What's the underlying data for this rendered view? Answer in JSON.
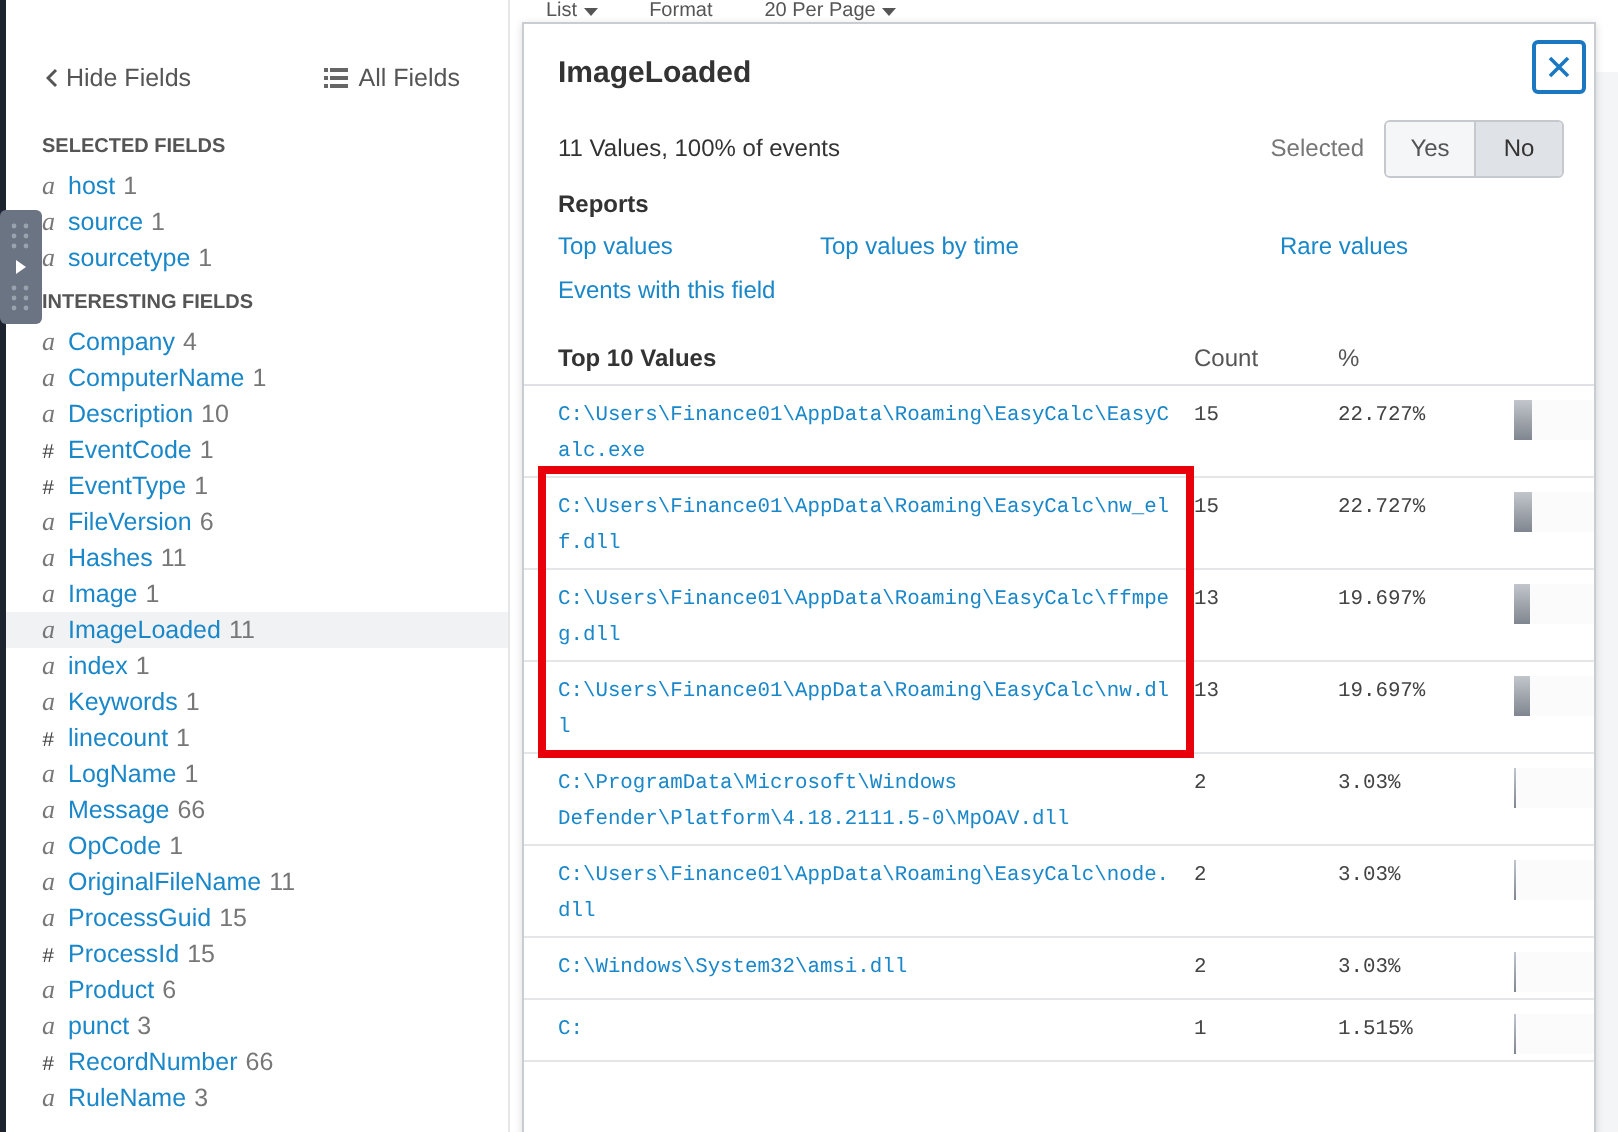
{
  "toolbar": [
    {
      "label": "List",
      "caret": true
    },
    {
      "label": "Format",
      "caret": false
    },
    {
      "label": "20 Per Page",
      "caret": true
    }
  ],
  "sidebar": {
    "hide_label": "Hide Fields",
    "all_label": "All Fields",
    "sections": [
      {
        "title": "SELECTED FIELDS",
        "fields": [
          {
            "type": "a",
            "name": "host",
            "count": "1",
            "selected": false
          },
          {
            "type": "a",
            "name": "source",
            "count": "1",
            "selected": false
          },
          {
            "type": "a",
            "name": "sourcetype",
            "count": "1",
            "selected": false
          }
        ]
      },
      {
        "title": "INTERESTING FIELDS",
        "fields": [
          {
            "type": "a",
            "name": "Company",
            "count": "4",
            "selected": false
          },
          {
            "type": "a",
            "name": "ComputerName",
            "count": "1",
            "selected": false
          },
          {
            "type": "a",
            "name": "Description",
            "count": "10",
            "selected": false
          },
          {
            "type": "#",
            "name": "EventCode",
            "count": "1",
            "selected": false
          },
          {
            "type": "#",
            "name": "EventType",
            "count": "1",
            "selected": false
          },
          {
            "type": "a",
            "name": "FileVersion",
            "count": "6",
            "selected": false
          },
          {
            "type": "a",
            "name": "Hashes",
            "count": "11",
            "selected": false
          },
          {
            "type": "a",
            "name": "Image",
            "count": "1",
            "selected": false
          },
          {
            "type": "a",
            "name": "ImageLoaded",
            "count": "11",
            "selected": true
          },
          {
            "type": "a",
            "name": "index",
            "count": "1",
            "selected": false
          },
          {
            "type": "a",
            "name": "Keywords",
            "count": "1",
            "selected": false
          },
          {
            "type": "#",
            "name": "linecount",
            "count": "1",
            "selected": false
          },
          {
            "type": "a",
            "name": "LogName",
            "count": "1",
            "selected": false
          },
          {
            "type": "a",
            "name": "Message",
            "count": "66",
            "selected": false
          },
          {
            "type": "a",
            "name": "OpCode",
            "count": "1",
            "selected": false
          },
          {
            "type": "a",
            "name": "OriginalFileName",
            "count": "11",
            "selected": false
          },
          {
            "type": "a",
            "name": "ProcessGuid",
            "count": "15",
            "selected": false
          },
          {
            "type": "#",
            "name": "ProcessId",
            "count": "15",
            "selected": false
          },
          {
            "type": "a",
            "name": "Product",
            "count": "6",
            "selected": false
          },
          {
            "type": "a",
            "name": "punct",
            "count": "3",
            "selected": false
          },
          {
            "type": "#",
            "name": "RecordNumber",
            "count": "66",
            "selected": false
          },
          {
            "type": "a",
            "name": "RuleName",
            "count": "3",
            "selected": false
          }
        ]
      }
    ]
  },
  "popup": {
    "title": "ImageLoaded",
    "summary": "11 Values, 100% of events",
    "selected_label": "Selected",
    "toggle": [
      {
        "label": "Yes",
        "selected": false
      },
      {
        "label": "No",
        "selected": true
      }
    ],
    "reports_title": "Reports",
    "reports": [
      "Top values",
      "Top values by time",
      "Rare values",
      "Events with this field"
    ],
    "table": {
      "columns": [
        "Top 10 Values",
        "Count",
        "%"
      ],
      "rows": [
        {
          "value": "C:\\Users\\Finance01\\AppData\\Roaming\\EasyCalc\\EasyCalc.exe",
          "count": "15",
          "percent": "22.727%",
          "level": 0.22727,
          "highlighted": false
        },
        {
          "value": "C:\\Users\\Finance01\\AppData\\Roaming\\EasyCalc\\nw_elf.dll",
          "count": "15",
          "percent": "22.727%",
          "level": 0.22727,
          "highlighted": true
        },
        {
          "value": "C:\\Users\\Finance01\\AppData\\Roaming\\EasyCalc\\ffmpeg.dll",
          "count": "13",
          "percent": "19.697%",
          "level": 0.19697,
          "highlighted": true
        },
        {
          "value": "C:\\Users\\Finance01\\AppData\\Roaming\\EasyCalc\\nw.dll",
          "count": "13",
          "percent": "19.697%",
          "level": 0.19697,
          "highlighted": true
        },
        {
          "value": "C:\\ProgramData\\Microsoft\\Windows Defender\\Platform\\4.18.2111.5-0\\MpOAV.dll",
          "count": "2",
          "percent": "3.03%",
          "level": 0.0303,
          "highlighted": false
        },
        {
          "value": "C:\\Users\\Finance01\\AppData\\Roaming\\EasyCalc\\node.dll",
          "count": "2",
          "percent": "3.03%",
          "level": 0.0303,
          "highlighted": false
        },
        {
          "value": "C:\\Windows\\System32\\amsi.dll",
          "count": "2",
          "percent": "3.03%",
          "level": 0.0303,
          "highlighted": false
        },
        {
          "value": "C:",
          "count": "1",
          "percent": "1.515%",
          "level": 0.01515,
          "highlighted": false
        }
      ]
    }
  }
}
